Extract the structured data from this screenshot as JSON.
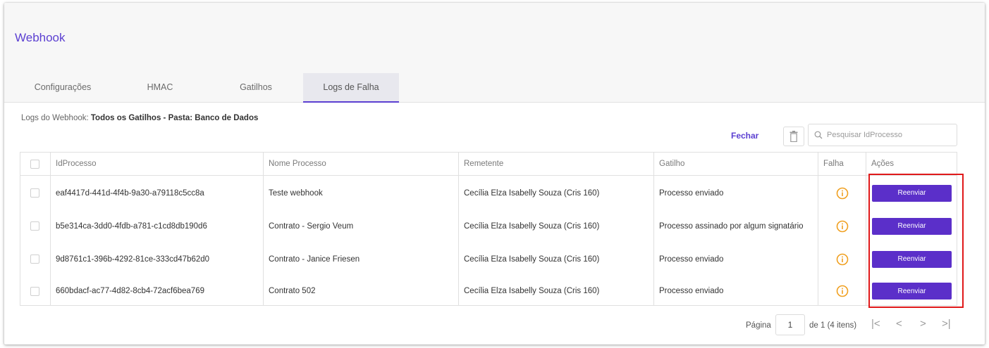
{
  "page": {
    "title": "Webhook"
  },
  "tabs": [
    {
      "label": "Configurações"
    },
    {
      "label": "HMAC"
    },
    {
      "label": "Gatilhos"
    },
    {
      "label": "Logs de Falha"
    }
  ],
  "logs": {
    "prefix": "Logs do Webhook: ",
    "filter": "Todos os Gatilhos - Pasta: Banco de Dados"
  },
  "toolbar": {
    "close_label": "Fechar",
    "delete_icon": "trash-icon",
    "search_placeholder": "Pesquisar IdProcesso",
    "search_icon": "search-icon"
  },
  "table": {
    "columns": [
      "IdProcesso",
      "Nome Processo",
      "Remetente",
      "Gatilho",
      "Falha",
      "Ações"
    ],
    "rows": [
      {
        "id": "eaf4417d-441d-4f4b-9a30-a79118c5cc8a",
        "name": "Teste webhook",
        "sender": "Cecília Elza Isabelly Souza (Cris 160)",
        "trigger": "Processo enviado",
        "action": "Reenviar"
      },
      {
        "id": "b5e314ca-3dd0-4fdb-a781-c1cd8db190d6",
        "name": "Contrato - Sergio Veum",
        "sender": "Cecília Elza Isabelly Souza (Cris 160)",
        "trigger": "Processo assinado por algum signatário",
        "action": "Reenviar"
      },
      {
        "id": "9d8761c1-396b-4292-81ce-333cd47b62d0",
        "name": "Contrato - Janice Friesen",
        "sender": "Cecília Elza Isabelly Souza (Cris 160)",
        "trigger": "Processo enviado",
        "action": "Reenviar"
      },
      {
        "id": "660bdacf-ac77-4d82-8cb4-72acf6bea769",
        "name": "Contrato 502",
        "sender": "Cecília Elza Isabelly Souza (Cris 160)",
        "trigger": "Processo enviado",
        "action": "Reenviar"
      }
    ]
  },
  "pagination": {
    "label": "Página",
    "current": "1",
    "total_text": "de 1 (4 itens)"
  },
  "colors": {
    "accent": "#5b2fc9",
    "title": "#5b3fd1",
    "warning": "#f0a020",
    "highlight": "#e0191a"
  }
}
